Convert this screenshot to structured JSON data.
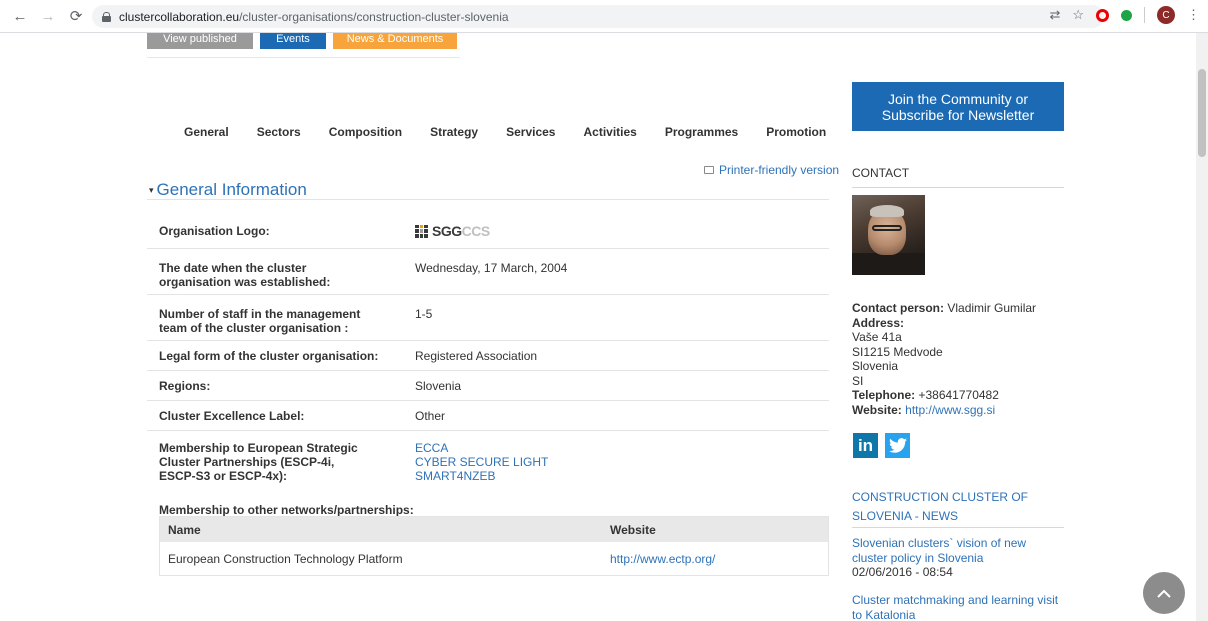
{
  "browser": {
    "url_host": "clustercollaboration.eu",
    "url_path": "/cluster-organisations/construction-cluster-slovenia",
    "profile_initial": "C"
  },
  "top_buttons": {
    "view_published": "View published",
    "events": "Events",
    "news_documents": "News & Documents"
  },
  "tabs": [
    "General",
    "Sectors",
    "Composition",
    "Strategy",
    "Services",
    "Activities",
    "Programmes",
    "Promotion"
  ],
  "printer_link": "Printer-friendly version",
  "section_title": "General Information",
  "info": {
    "logo_label": "Organisation Logo:",
    "logo_text_a": "SGG",
    "logo_text_b": "CCS",
    "date_label": "The date when the cluster organisation was established:",
    "date_value": "Wednesday, 17 March, 2004",
    "staff_label": "Number of staff in the management team of the cluster organisation :",
    "staff_value": "1-5",
    "legal_label": "Legal form of the cluster organisation:",
    "legal_value": "Registered Association",
    "regions_label": "Regions:",
    "regions_value": "Slovenia",
    "excellence_label": "Cluster Excellence Label:",
    "excellence_value": "Other",
    "escp_label": "Membership to European Strategic Cluster Partnerships (ESCP-4i, ESCP-S3 or ESCP-4x):",
    "escp_values": [
      "ECCA",
      "CYBER SECURE LIGHT",
      "SMART4NZEB"
    ]
  },
  "membership": {
    "title": "Membership to other networks/partnerships:",
    "col_name": "Name",
    "col_website": "Website",
    "rows": [
      {
        "name": "European Construction Technology Platform",
        "website": "http://www.ectp.org/"
      }
    ]
  },
  "sidebar": {
    "join_line1": "Join the Community or",
    "join_line2": "Subscribe for Newsletter",
    "contact_head": "CONTACT",
    "contact_person_label": "Contact person:",
    "contact_person": "Vladimir Gumilar",
    "address_label": "Address:",
    "address_lines": [
      "Vaše 41a",
      "SI1215 Medvode",
      "Slovenia",
      "SI"
    ],
    "telephone_label": "Telephone:",
    "telephone": "+38641770482",
    "website_label": "Website:",
    "website": "http://www.sgg.si",
    "linkedin": "in",
    "news_head": "CONSTRUCTION CLUSTER OF SLOVENIA - NEWS",
    "news": [
      {
        "title": "Slovenian clusters` vision of new cluster policy in Slovenia",
        "date": "02/06/2016 - 08:54"
      },
      {
        "title": "Cluster matchmaking and learning visit to Katalonia",
        "date": ""
      }
    ]
  }
}
